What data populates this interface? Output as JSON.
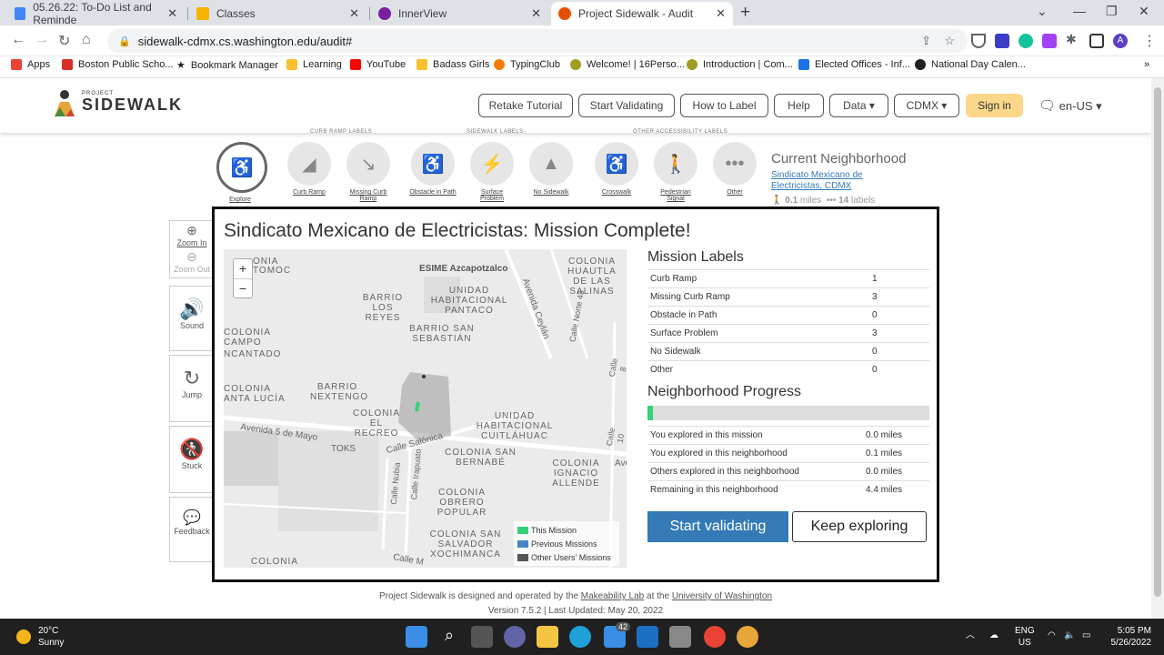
{
  "browser": {
    "tabs": [
      {
        "title": "05.26.22: To-Do List and Reminde",
        "color": "#4285f4",
        "active": false
      },
      {
        "title": "Classes",
        "color": "#f4b400",
        "active": false
      },
      {
        "title": "InnerView",
        "color": "#7b1fa2",
        "active": false
      },
      {
        "title": "Project Sidewalk - Audit",
        "color": "#e65100",
        "active": true
      }
    ],
    "new_tab": "+",
    "url": "sidewalk-cdmx.cs.washington.edu/audit#",
    "profile_initial": "A"
  },
  "bookmarks": [
    {
      "label": "Apps",
      "color": "#ea4335"
    },
    {
      "label": "Boston Public Scho...",
      "color": "#d93025"
    },
    {
      "label": "Bookmark Manager",
      "color": "#202124"
    },
    {
      "label": "Learning",
      "color": "#fbc02d"
    },
    {
      "label": "YouTube",
      "color": "#ff0000"
    },
    {
      "label": "Badass Girls",
      "color": "#fbc02d"
    },
    {
      "label": "TypingClub",
      "color": "#f57c00"
    },
    {
      "label": "Welcome! | 16Perso...",
      "color": "#9e9d24"
    },
    {
      "label": "Introduction | Com...",
      "color": "#9e9d24"
    },
    {
      "label": "Elected Offices - Inf...",
      "color": "#1a73e8"
    },
    {
      "label": "National Day Calen...",
      "color": "#202124"
    }
  ],
  "header": {
    "logo_small": "PROJECT",
    "logo_text": "SIDEWALK",
    "buttons": [
      "Retake Tutorial",
      "Start Validating",
      "How to Label",
      "Help",
      "Data ▾",
      "CDMX ▾"
    ],
    "signin": "Sign in",
    "lang": "en-US ▾"
  },
  "label_types": [
    {
      "caption": "Explore",
      "icon": "♿"
    },
    {
      "caption": "Curb Ramp",
      "icon": "◢"
    },
    {
      "caption": "Missing Curb Ramp",
      "icon": "↘"
    },
    {
      "caption": "Obstacle in Path",
      "icon": "♿"
    },
    {
      "caption": "Surface Problem",
      "icon": "⚡"
    },
    {
      "caption": "No Sidewalk",
      "icon": "▲"
    },
    {
      "caption": "Crosswalk",
      "icon": "♿"
    },
    {
      "caption": "Pedestrian Signal",
      "icon": "🚶"
    },
    {
      "caption": "Other",
      "icon": "•••"
    }
  ],
  "label_groups": [
    "CURB RAMP LABELS",
    "SIDEWALK LABELS",
    "OTHER ACCESSIBILITY LABELS"
  ],
  "current_neighborhood": {
    "title": "Current Neighborhood",
    "name": "Sindicato Mexicano de Electricistas, CDMX",
    "miles": "0.1",
    "miles_unit": "miles",
    "labels": "14",
    "labels_unit": "labels"
  },
  "sidebar": {
    "zoom_in": "Zoom In",
    "zoom_out": "Zoom Out",
    "sound": "Sound",
    "jump": "Jump",
    "stuck": "Stuck",
    "feedback": "Feedback"
  },
  "modal": {
    "title": "Sindicato Mexicano de Electricistas: Mission Complete!",
    "map": {
      "zoom_in": "+",
      "zoom_out": "−",
      "labels": [
        "ESIME Azcapotzalco",
        "Colonia Huautla de las Salinas",
        "Unidad Habitacional Pantaco",
        "Barrio Los Reyes",
        "Barrio San Sebastián",
        "Colonia Campo",
        "Ncantado",
        "Barrio Nextengo",
        "Colonia Anta Lucía",
        "Colonia El Recreo",
        "Unidad Habitacional Cuitláhuac",
        "Colonia San Bernabé",
        "Colonia Ignacio Allende",
        "Colonia Obrero Popular",
        "Colonia San Salvador Xochimanca",
        "Colonia",
        "Avenida Ceylán",
        "Calle Norte 45",
        "Avenida 5 de Mayo",
        "TOKS",
        "Calle Salónica",
        "Calle Nubia",
        "Calle Irapuato",
        "Calle 8",
        "Calle 10",
        "Ave",
        "Calle M",
        "TOMOC",
        "ONIA"
      ],
      "legend": [
        {
          "label": "This Mission",
          "color": "#33d17a"
        },
        {
          "label": "Previous Missions",
          "color": "#4a86c5"
        },
        {
          "label": "Other Users' Missions",
          "color": "#555555"
        }
      ]
    },
    "mission_labels_title": "Mission Labels",
    "mission_labels": [
      {
        "name": "Curb Ramp",
        "count": "1"
      },
      {
        "name": "Missing Curb Ramp",
        "count": "3"
      },
      {
        "name": "Obstacle in Path",
        "count": "0"
      },
      {
        "name": "Surface Problem",
        "count": "3"
      },
      {
        "name": "No Sidewalk",
        "count": "0"
      },
      {
        "name": "Other",
        "count": "0"
      }
    ],
    "progress_title": "Neighborhood Progress",
    "progress_fraction": 0.02,
    "progress_rows": [
      {
        "name": "You explored in this mission",
        "value": "0.0 miles"
      },
      {
        "name": "You explored in this neighborhood",
        "value": "0.1 miles"
      },
      {
        "name": "Others explored in this neighborhood",
        "value": "0.0 miles"
      },
      {
        "name": "Remaining in this neighborhood",
        "value": "4.4 miles"
      }
    ],
    "start_validating": "Start validating",
    "keep_exploring": "Keep exploring"
  },
  "footer": {
    "line1_pre": "Project Sidewalk is designed and operated by the",
    "lab": "Makeability Lab",
    "line1_mid": "at the",
    "uni": "University of Washington",
    "line2": "Version 7.5.2 | Last Updated: May 20, 2022"
  },
  "taskbar": {
    "temp": "20°C",
    "condition": "Sunny",
    "lang1": "ENG",
    "lang2": "US",
    "time": "5:05 PM",
    "date": "5/26/2022",
    "mail_badge": "42"
  }
}
